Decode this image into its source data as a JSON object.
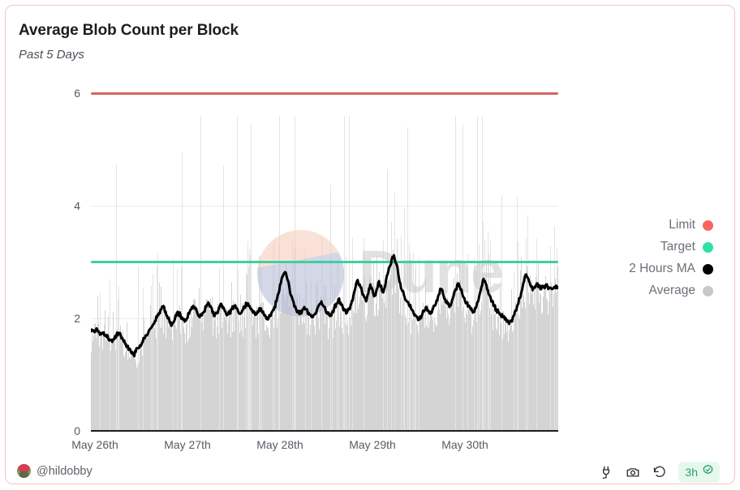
{
  "card": {
    "title": "Average Blob Count per Block",
    "subtitle": "Past 5 Days",
    "border_color": "#f1c9c4"
  },
  "footer": {
    "author_handle": "@hildobby",
    "avatar_icon": "user-avatar",
    "tools": [
      {
        "name": "embed-icon",
        "label": "embed"
      },
      {
        "name": "camera-icon",
        "label": "screenshot"
      },
      {
        "name": "refresh-icon",
        "label": "refresh"
      }
    ],
    "freshness_label": "3h",
    "freshness_icon": "verified-check-icon",
    "freshness_color": "#26a269"
  },
  "chart_data": {
    "type": "bar",
    "title": "Average Blob Count per Block",
    "subtitle": "Past 5 Days",
    "xlabel": "",
    "ylabel": "",
    "ylim": [
      0,
      6
    ],
    "yticks": [
      0,
      2,
      4,
      6
    ],
    "xticks": [
      "May 26th",
      "May 27th",
      "May 28th",
      "May 29th",
      "May 30th"
    ],
    "grid": true,
    "legend_position": "right",
    "legend": [
      {
        "name": "Limit",
        "color": "#f8665d",
        "kind": "hline",
        "value": 6
      },
      {
        "name": "Target",
        "color": "#2ee0a4",
        "kind": "hline",
        "value": 3
      },
      {
        "name": "2 Hours MA",
        "color": "#000000",
        "kind": "line"
      },
      {
        "name": "Average",
        "color": "#c8c8c8",
        "kind": "bar"
      }
    ],
    "reference_lines": [
      {
        "name": "Limit",
        "value": 6,
        "color": "#d9655f"
      },
      {
        "name": "Target",
        "value": 3,
        "color": "#3ecfa0"
      }
    ],
    "series": [
      {
        "name": "2 Hours MA",
        "color": "#000000",
        "values": [
          1.77,
          1.79,
          1.76,
          1.8,
          1.74,
          1.72,
          1.75,
          1.7,
          1.66,
          1.62,
          1.58,
          1.63,
          1.71,
          1.74,
          1.7,
          1.62,
          1.55,
          1.5,
          1.44,
          1.38,
          1.35,
          1.4,
          1.47,
          1.52,
          1.57,
          1.64,
          1.7,
          1.76,
          1.82,
          1.88,
          1.95,
          2.02,
          2.1,
          2.16,
          2.22,
          2.12,
          2.0,
          1.92,
          1.88,
          1.95,
          2.04,
          2.1,
          2.05,
          1.98,
          1.94,
          2.0,
          2.08,
          2.16,
          2.22,
          2.16,
          2.08,
          2.02,
          2.05,
          2.12,
          2.2,
          2.28,
          2.22,
          2.1,
          2.04,
          2.1,
          2.18,
          2.26,
          2.2,
          2.12,
          2.06,
          2.1,
          2.16,
          2.22,
          2.18,
          2.12,
          2.08,
          2.14,
          2.2,
          2.26,
          2.22,
          2.16,
          2.1,
          2.06,
          2.12,
          2.18,
          2.14,
          2.08,
          2.02,
          1.98,
          2.04,
          2.12,
          2.2,
          2.3,
          2.45,
          2.62,
          2.75,
          2.82,
          2.7,
          2.55,
          2.4,
          2.28,
          2.18,
          2.12,
          2.08,
          2.14,
          2.2,
          2.16,
          2.1,
          2.06,
          2.02,
          2.08,
          2.16,
          2.24,
          2.3,
          2.22,
          2.14,
          2.08,
          2.04,
          2.1,
          2.18,
          2.26,
          2.34,
          2.28,
          2.2,
          2.14,
          2.1,
          2.16,
          2.26,
          2.4,
          2.55,
          2.68,
          2.6,
          2.48,
          2.38,
          2.3,
          2.44,
          2.6,
          2.5,
          2.4,
          2.52,
          2.66,
          2.58,
          2.46,
          2.6,
          2.78,
          2.92,
          3.05,
          3.12,
          2.98,
          2.8,
          2.62,
          2.48,
          2.38,
          2.3,
          2.24,
          2.18,
          2.12,
          2.06,
          2.02,
          1.98,
          2.04,
          2.12,
          2.2,
          2.14,
          2.08,
          2.14,
          2.22,
          2.32,
          2.42,
          2.52,
          2.44,
          2.34,
          2.26,
          2.2,
          2.28,
          2.4,
          2.52,
          2.62,
          2.54,
          2.44,
          2.36,
          2.28,
          2.22,
          2.16,
          2.1,
          2.18,
          2.28,
          2.4,
          2.55,
          2.7,
          2.62,
          2.5,
          2.4,
          2.3,
          2.22,
          2.16,
          2.1,
          2.06,
          2.02,
          1.98,
          1.94,
          1.9,
          1.95,
          2.04,
          2.14,
          2.24,
          2.36,
          2.5,
          2.66,
          2.78,
          2.7,
          2.58,
          2.5,
          2.56,
          2.62,
          2.58,
          2.52,
          2.55,
          2.58,
          2.56,
          2.54,
          2.52,
          2.55,
          2.58,
          2.56
        ]
      },
      {
        "name": "Average",
        "color": "#d8d8d8",
        "description": "per-block average blob count, dense vertical bars ranging 0 to ~5.5",
        "range": [
          0,
          5.5
        ],
        "baseline": 2.0
      }
    ],
    "watermark": {
      "text": "Dune",
      "logo_colors": [
        "#f6cfc0",
        "#b9bfd8"
      ]
    }
  }
}
